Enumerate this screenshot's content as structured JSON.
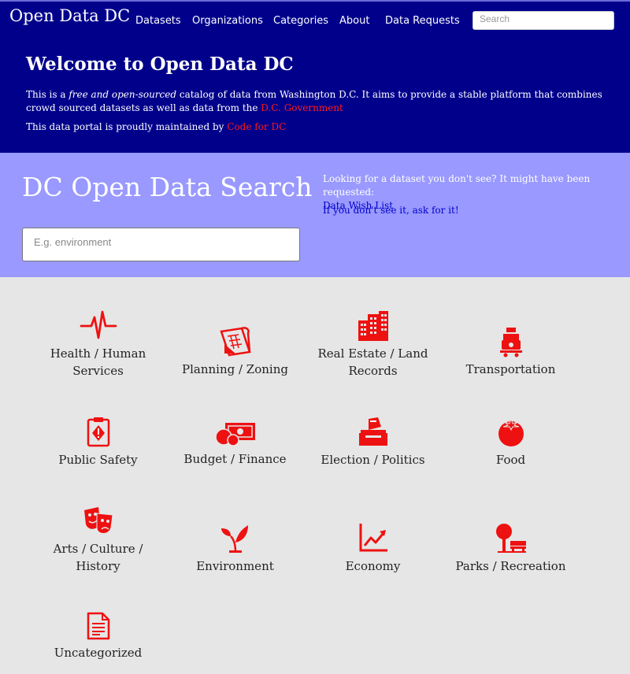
{
  "nav": {
    "brand": "Open Data DC",
    "items": [
      "Datasets",
      "Organizations",
      "Categories",
      "About",
      "Data Requests"
    ],
    "search_placeholder": "Search"
  },
  "welcome": {
    "title": "Welcome to Open Data DC",
    "p1_pre": "This is a ",
    "p1_em": "free and open-sourced",
    "p1_mid": " catalog of data from Washington D.C. It aims to provide a stable platform that combines crowd sourced datasets as well as data from the ",
    "p1_link": "D.C. Government",
    "p2_pre": "This data portal is proudly maintained by ",
    "p2_link": "Code for DC"
  },
  "search": {
    "title": "DC Open Data Search",
    "placeholder": "E.g. environment",
    "wish_text": "Looking for a dataset you don't see? It might have been requested:",
    "wish_link": "Data Wish List",
    "ask_link": "If you don't see it, ask for it!"
  },
  "categories": [
    {
      "label": "Health / Human Services",
      "icon": "heartbeat-icon"
    },
    {
      "label": "Planning / Zoning",
      "icon": "blueprint-icon"
    },
    {
      "label": "Real Estate / Land Records",
      "icon": "buildings-icon"
    },
    {
      "label": "Transportation",
      "icon": "train-icon"
    },
    {
      "label": "Public Safety",
      "icon": "clipboard-warning-icon"
    },
    {
      "label": "Budget / Finance",
      "icon": "money-icon"
    },
    {
      "label": "Election / Politics",
      "icon": "ballot-box-icon"
    },
    {
      "label": "Food",
      "icon": "tomato-icon"
    },
    {
      "label": "Arts / Culture / History",
      "icon": "theater-masks-icon"
    },
    {
      "label": "Environment",
      "icon": "plant-icon"
    },
    {
      "label": "Economy",
      "icon": "line-chart-icon"
    },
    {
      "label": "Parks / Recreation",
      "icon": "park-bench-icon"
    },
    {
      "label": "Uncategorized",
      "icon": "document-icon"
    }
  ],
  "colors": {
    "navy": "#00008b",
    "lavender": "#9999ff",
    "accent_red": "#ee1111",
    "background": "#e6e6e6"
  }
}
